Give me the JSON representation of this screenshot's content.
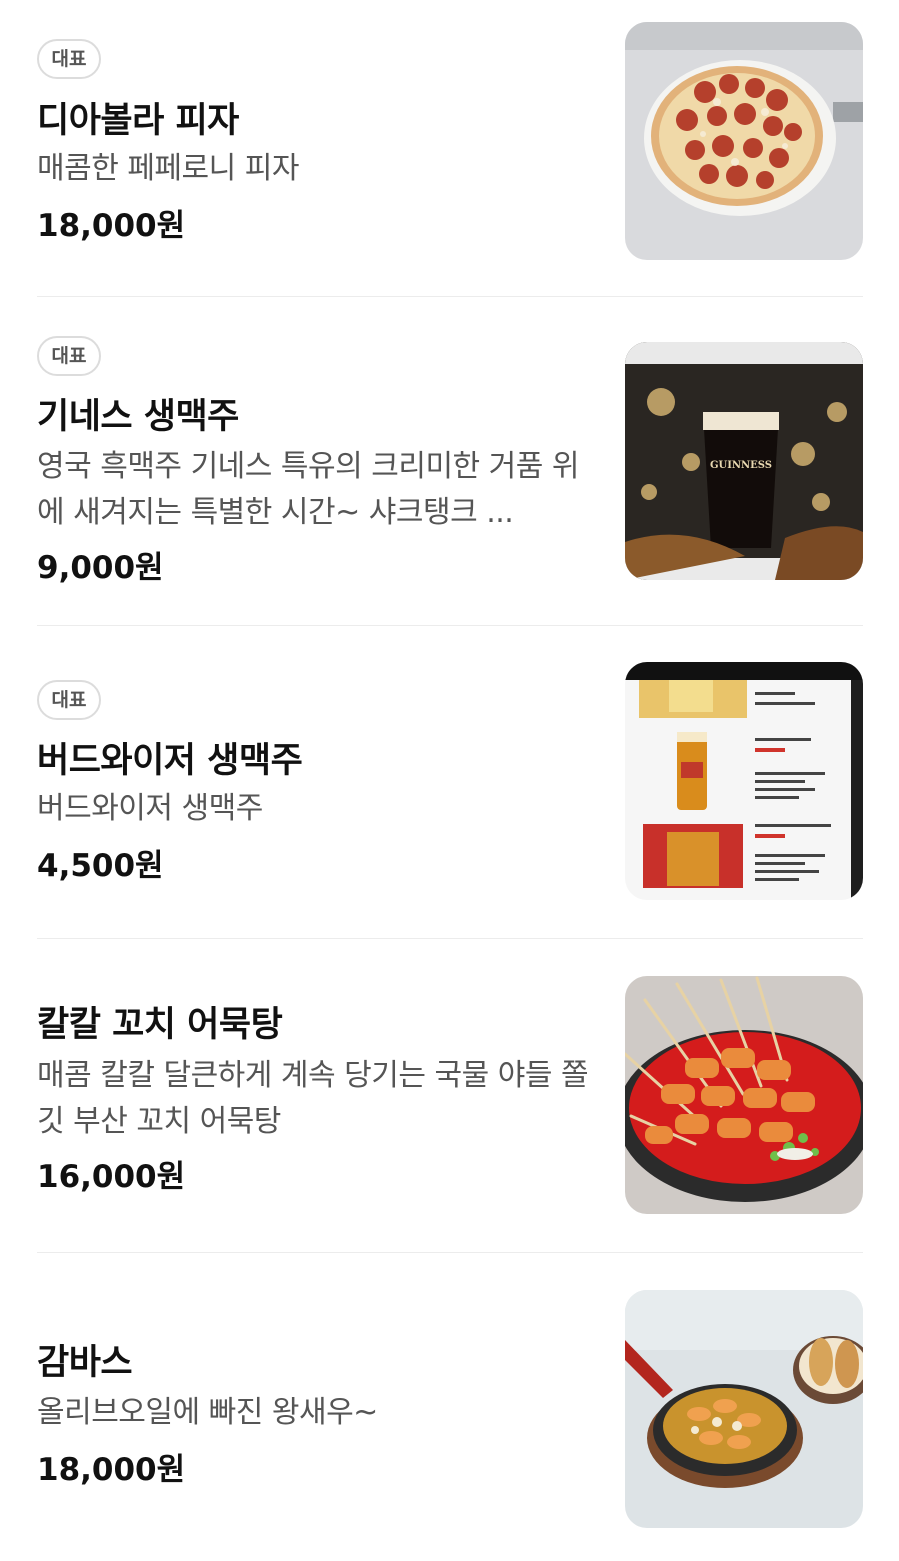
{
  "menu": {
    "items": [
      {
        "badge": "대표",
        "name": "디아볼라 피자",
        "description": "매콤한 페페로니 피자",
        "price": "18,000원",
        "image_icon": "pepperoni-pizza-photo"
      },
      {
        "badge": "대표",
        "name": "기네스 생맥주",
        "description": "영국 흑맥주 기네스 특유의 크리미한 거품 위에 새겨지는 특별한 시간~ 샤크탱크 ...",
        "price": "9,000원",
        "image_icon": "guinness-beer-photo",
        "image_text": "GUINNESS"
      },
      {
        "badge": "대표",
        "name": "버드와이저 생맥주",
        "description": "버드와이저 생맥주",
        "price": "4,500원",
        "image_icon": "budweiser-menu-photo"
      },
      {
        "name": "칼칼 꼬치 어묵탕",
        "description": "매콤 칼칼 달큰하게 계속 당기는 국물 야들 쫄깃 부산 꼬치 어묵탕",
        "price": "16,000원",
        "image_icon": "fishcake-skewer-stew-photo"
      },
      {
        "name": "감바스",
        "description": "올리브오일에 빠진 왕새우~",
        "price": "18,000원",
        "image_icon": "gambas-shrimp-photo"
      }
    ]
  },
  "colors": {
    "text_primary": "#111111",
    "text_secondary": "#555555",
    "badge_border": "#dcdcdc",
    "divider": "#ececec"
  }
}
